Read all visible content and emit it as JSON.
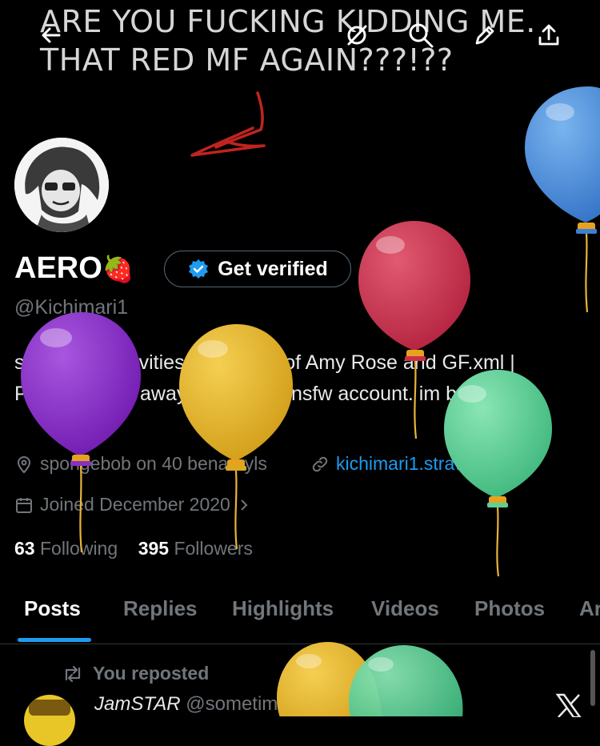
{
  "overlay": {
    "caption_line1": "ARE YOU FUCKING KIDDING ME.",
    "caption_line2": "THAT RED MF AGAIN???!??"
  },
  "topbar": {
    "icons": [
      "back-arrow-icon",
      "anti-grok-icon",
      "search-icon",
      "edit-pencil-icon",
      "share-icon"
    ]
  },
  "profile": {
    "name": "AERO",
    "emoji": "🍓",
    "verify_label": "Get verified",
    "handle": "@Kichimari1",
    "bio": "silly goofy activities | huge fan of Amy Rose and GF.xml | PLEASE stay away if youre an nsfw account. im begging.",
    "location": "spongebob on 40 benadryls",
    "website": "kichimari1.straw.page",
    "joined": "Joined December 2020",
    "following_count": "63",
    "following_label": "Following",
    "followers_count": "395",
    "followers_label": "Followers"
  },
  "tabs": [
    "Posts",
    "Replies",
    "Highlights",
    "Videos",
    "Photos",
    "Ar"
  ],
  "feed": {
    "repost_text": "You reposted",
    "author_name": "JamSTAR",
    "author_handle": "@sometimes31..."
  },
  "colors": {
    "accent": "#1d9bf0",
    "balloon_blue": "#4a8fdc",
    "balloon_red": "#c8344c",
    "balloon_purple": "#8a2fc4",
    "balloon_yellow": "#e5b52c",
    "balloon_green": "#5fcf94",
    "arrow_red": "#c0241f"
  }
}
